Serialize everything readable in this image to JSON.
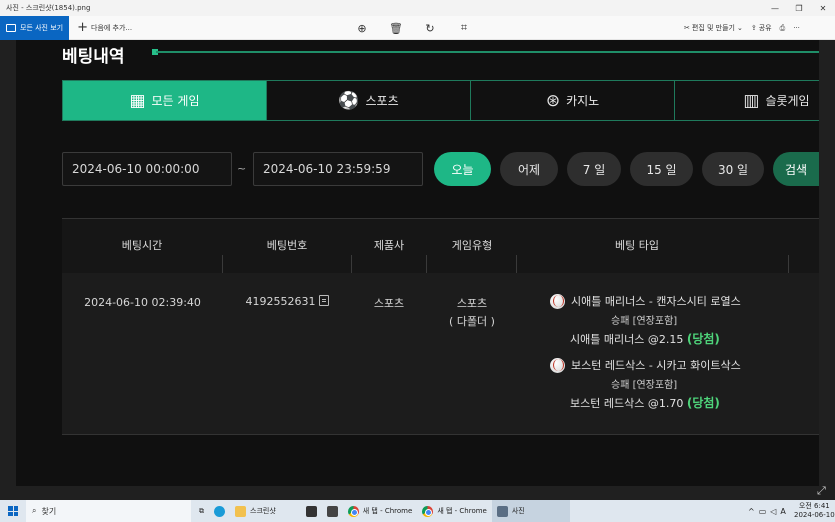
{
  "window": {
    "title": "사진 - 스크린샷(1854).png",
    "controls": [
      "—",
      "❐",
      "✕"
    ]
  },
  "toolbar": {
    "all_photos": "모든 사진 보기",
    "add_to": "다음에 추가...",
    "edit_create": "편집 및 만들기",
    "share": "공유"
  },
  "page": {
    "section_title": "베팅내역",
    "tabs": [
      {
        "label": "모든 게임",
        "icon": "grid-icon"
      },
      {
        "label": "스포츠",
        "icon": "soccer-ball-icon"
      },
      {
        "label": "카지노",
        "icon": "casino-chip-icon"
      },
      {
        "label": "슬롯게임",
        "icon": "slot-machine-icon"
      }
    ],
    "date_from": "2024-06-10 00:00:00",
    "date_to": "2024-06-10 23:59:59",
    "date_separator": "~",
    "quick_ranges": [
      "오늘",
      "어제",
      "7 일",
      "15 일",
      "30 일"
    ],
    "search_label": "검색",
    "columns": [
      "베팅시간",
      "베팅번호",
      "제품사",
      "게임유형",
      "베팅 타입"
    ],
    "row": {
      "time": "2024-06-10 02:39:40",
      "bet_number": "4192552631",
      "provider": "스포츠",
      "game_type": "스포츠",
      "game_type_sub": "( 다폴더 )",
      "bets": [
        {
          "match": "시애틀 매리너스 - 캔자스시티 로열스",
          "market": "승패 [연장포함]",
          "pick": "시애틀 매리너스",
          "odds": "@2.15",
          "result": "(당첨)"
        },
        {
          "match": "보스턴 레드삭스 - 시카고 화이트삭스",
          "market": "승패 [연장포함]",
          "pick": "보스턴 레드삭스",
          "odds": "@1.70",
          "result": "(당첨)"
        }
      ]
    }
  },
  "taskbar": {
    "search": "찾기",
    "explorer": "스크린샷",
    "chrome1": "새 탭 - Chrome",
    "chrome2": "새 탭 - Chrome",
    "photos": "사진",
    "lang": "A",
    "time": "오전 6:41",
    "date": "2024-06-10"
  }
}
